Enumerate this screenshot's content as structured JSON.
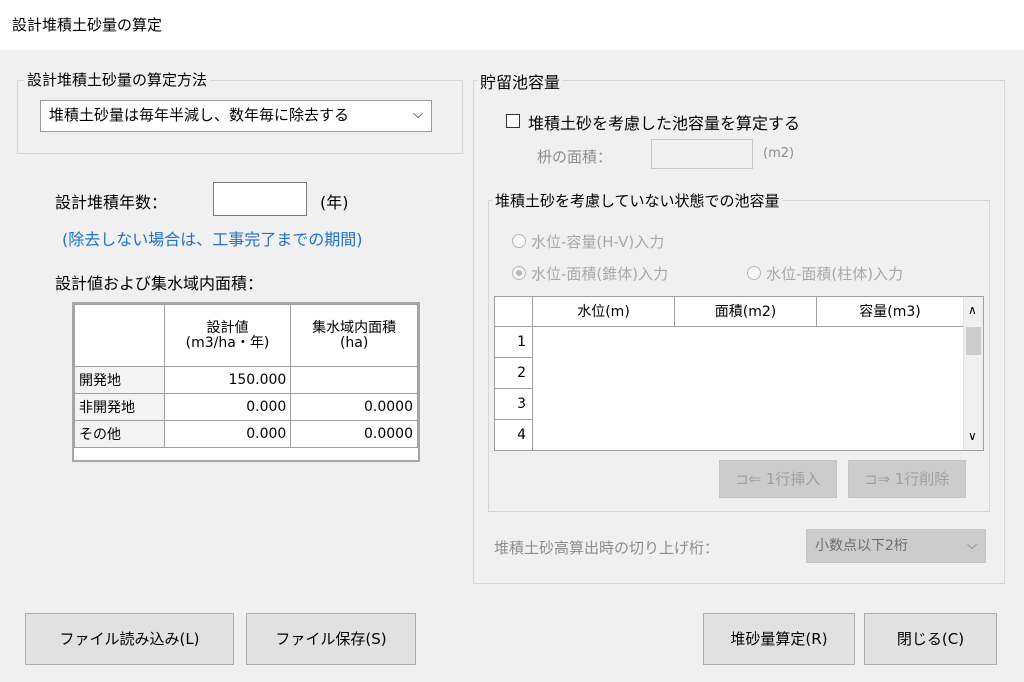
{
  "window": {
    "title": "設計堆積土砂量の算定"
  },
  "method": {
    "group_title": "設計堆積土砂量の算定方法",
    "selected": "堆積土砂量は毎年半減し、数年毎に除去する",
    "chevron": "⌵"
  },
  "years": {
    "label": "設計堆積年数：",
    "value": "",
    "unit": "(年)",
    "note": "(除去しない場合は、工事完了までの期間)"
  },
  "design": {
    "label": "設計値および集水域内面積：",
    "col_value": [
      "設計値",
      "(m3/ha・年)"
    ],
    "col_area": [
      "集水域内面積",
      "(ha)"
    ],
    "rows": [
      {
        "name": "開発地",
        "value": "150.000",
        "area": ""
      },
      {
        "name": "非開発地",
        "value": "0.000",
        "area": "0.0000"
      },
      {
        "name": "その他",
        "value": "0.000",
        "area": "0.0000"
      }
    ]
  },
  "pond": {
    "group_title": "貯留池容量",
    "checkbox_label": "堆積土砂を考慮した池容量を算定する",
    "checked": false,
    "basin_label": "枡の面積：",
    "basin_value": "",
    "basin_unit": "(m2)",
    "sub_group_title": "堆積土砂を考慮していない状態での池容量",
    "radio_hv": "水位-容量(H-V)入力",
    "radio_cone": "水位-面積(錐体)入力",
    "radio_prism": "水位-面積(柱体)入力",
    "selected_radio": "cone",
    "grid_headers": [
      "水位(m)",
      "面積(m2)",
      "容量(m3)"
    ],
    "grid_rows": [
      "1",
      "2",
      "3",
      "4"
    ],
    "scroll_up": "∧",
    "scroll_down": "∨",
    "insert_label": "1行挿入",
    "delete_label": "1行削除",
    "roundup_label": "堆積土砂高算出時の切り上げ桁：",
    "roundup_value": "小数点以下2桁"
  },
  "buttons": {
    "load": "ファイル読み込み(L)",
    "save": "ファイル保存(S)",
    "calc": "堆砂量算定(R)",
    "close": "閉じる(C)"
  },
  "colors": {
    "note_blue": "#1e73c8",
    "background": "#f0f0f0"
  }
}
